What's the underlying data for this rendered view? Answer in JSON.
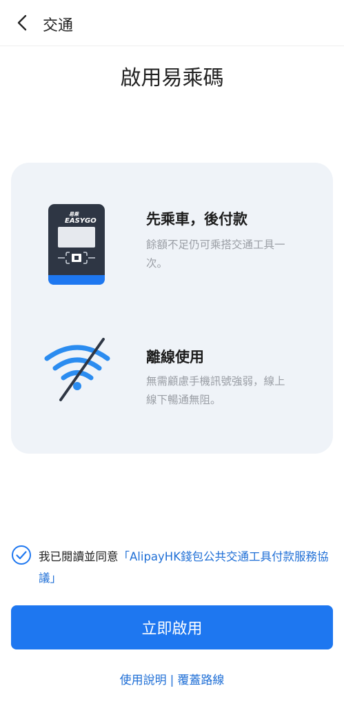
{
  "header": {
    "title": "交通"
  },
  "page": {
    "title": "啟用易乘碼"
  },
  "features": [
    {
      "title": "先乘車，後付款",
      "desc": "餘額不足仍可乘搭交通工具一次。"
    },
    {
      "title": "離線使用",
      "desc": "無需顧慮手機訊號強弱，線上線下暢通無阻。"
    }
  ],
  "logo": {
    "text_top": "易乘",
    "text_bottom": "EASYGO"
  },
  "agreement": {
    "checked": true,
    "prefix": "我已閱讀並同意",
    "link": "「AlipayHK錢包公共交通工具付款服務協議」"
  },
  "actions": {
    "enable_label": "立即啟用",
    "help_label": "使用說明",
    "separator": "|",
    "coverage_label": "覆蓋路線"
  },
  "colors": {
    "accent": "#1e77f0",
    "link": "#1f6fd6",
    "card_bg": "#eff3f8",
    "icon_blue": "#2b8cf0"
  },
  "icons": [
    "chevron-left-icon",
    "transit-device-icon",
    "offline-wifi-icon",
    "checked-circle-icon"
  ]
}
